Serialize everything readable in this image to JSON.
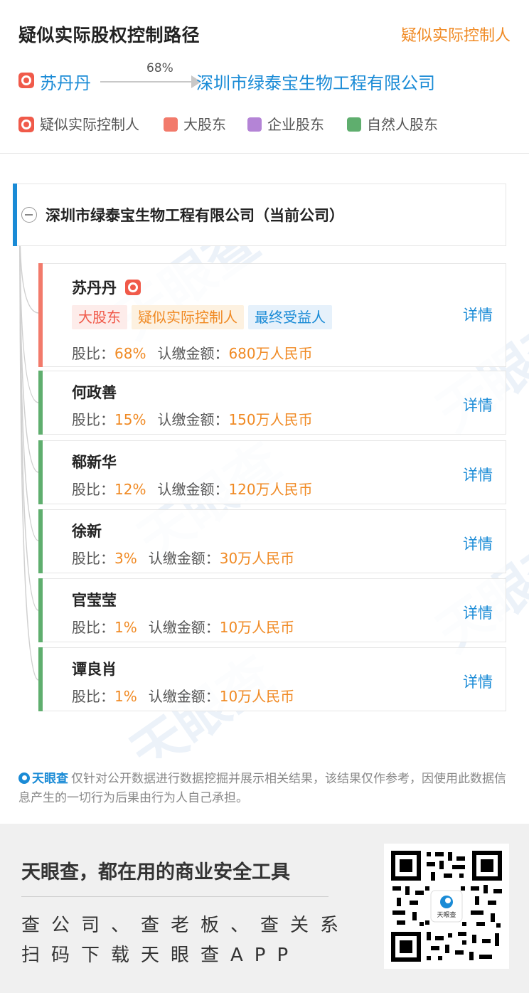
{
  "header": {
    "title": "疑似实际股权控制路径",
    "link": "疑似实际控制人"
  },
  "path": {
    "person": "苏丹丹",
    "percent": "68%",
    "company": "深圳市绿泰宝生物工程有限公司"
  },
  "legend": {
    "items": [
      {
        "label": "疑似实际控制人",
        "icon": "controller-icon"
      },
      {
        "label": "大股东",
        "color": "#f27a6b"
      },
      {
        "label": "企业股东",
        "color": "#b484d6"
      },
      {
        "label": "自然人股东",
        "color": "#5fae6e"
      }
    ]
  },
  "tree": {
    "company_label": "深圳市绿泰宝生物工程有限公司（当前公司）",
    "watermark": "天眼查",
    "shareholders": [
      {
        "name": "苏丹丹",
        "tags": [
          "大股东",
          "疑似实际控制人",
          "最终受益人"
        ],
        "share_label": "股比：",
        "share": "68%",
        "amount_label": "认缴金额：",
        "amount": "680万人民币",
        "detail": "详情",
        "stripe": "#f27a6b"
      },
      {
        "name": "何政善",
        "share_label": "股比：",
        "share": "15%",
        "amount_label": "认缴金额：",
        "amount": "150万人民币",
        "detail": "详情",
        "stripe": "#5fae6e"
      },
      {
        "name": "郗新华",
        "share_label": "股比：",
        "share": "12%",
        "amount_label": "认缴金额：",
        "amount": "120万人民币",
        "detail": "详情",
        "stripe": "#5fae6e"
      },
      {
        "name": "徐新",
        "share_label": "股比：",
        "share": "3%",
        "amount_label": "认缴金额：",
        "amount": "30万人民币",
        "detail": "详情",
        "stripe": "#5fae6e"
      },
      {
        "name": "官莹莹",
        "share_label": "股比：",
        "share": "1%",
        "amount_label": "认缴金额：",
        "amount": "10万人民币",
        "detail": "详情",
        "stripe": "#5fae6e"
      },
      {
        "name": "谭良肖",
        "share_label": "股比：",
        "share": "1%",
        "amount_label": "认缴金额：",
        "amount": "10万人民币",
        "detail": "详情",
        "stripe": "#5fae6e"
      }
    ]
  },
  "disclaimer": {
    "brand": "天眼查",
    "text": "仅针对公开数据进行数据挖掘并展示相关结果，该结果仅作参考，因使用此数据信息产生的一切行为后果由行为人自己承担。"
  },
  "banner": {
    "slogan": "天眼查，都在用的商业安全工具",
    "line1": "查公司、查老板、查关系",
    "line2": "扫码下载天眼查APP",
    "qr_center": "天眼查"
  }
}
